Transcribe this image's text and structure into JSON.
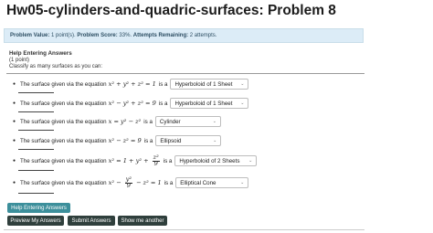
{
  "page": {
    "title": "Hw05-cylinders-and-quadric-surfaces: Problem 8"
  },
  "info_bar": {
    "value_label": "Problem Value:",
    "value_text": "1 point(s).",
    "score_label": "Problem Score:",
    "score_text": "33%.",
    "attempts_label": "Attempts Remaining:",
    "attempts_text": "2 attempts."
  },
  "problem": {
    "help_heading": "Help Entering Answers",
    "points": "(1 point)",
    "instruction": "Classify as many surfaces as you can:",
    "items": [
      {
        "prefix": "The surface given via the equation",
        "equation": "x² + y² + z² = 1",
        "suffix": "is a",
        "answer": "Hyperboloid of 1 Sheet"
      },
      {
        "prefix": "The surface given via the equation",
        "equation": "x² − y² + z² = 9",
        "suffix": "is a",
        "answer": "Hyperboloid of 1 Sheet"
      },
      {
        "prefix": "The surface given via the equation",
        "equation": "x = y² − z²",
        "suffix": "is a",
        "answer": "Cylinder"
      },
      {
        "prefix": "The surface given via the equation",
        "equation": "x² − z² = 9",
        "suffix": "is a",
        "answer": "Ellipsoid"
      },
      {
        "prefix": "The surface given via the equation",
        "equation_left": "x² = 1 + y² +",
        "frac_num": "z²",
        "frac_den": "9",
        "suffix": "is a",
        "answer": "Hyperboloid of 2 Sheets"
      },
      {
        "prefix": "The surface given via the equation",
        "equation_left": "x² −",
        "frac_num": "y²",
        "frac_den": "9",
        "equation_right": "− z² = 1",
        "suffix": "is a",
        "answer": "Elliptical Cone"
      }
    ]
  },
  "buttons": {
    "help": "Help Entering Answers",
    "preview": "Preview My Answers",
    "submit": "Submit Answers",
    "show_another": "Show me another"
  },
  "colors": {
    "info_bar_bg": "#dcecf7",
    "help_button": "#3c8f9b",
    "dark_button": "#2f3f3c"
  }
}
